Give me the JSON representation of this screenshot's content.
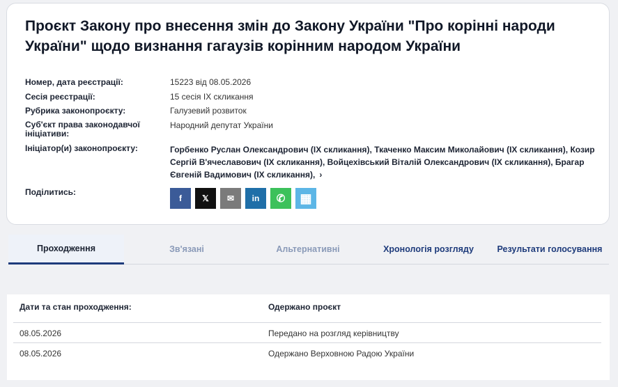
{
  "bill": {
    "title": "Проєкт Закону про внесення змін до Закону України \"Про корінні народи України\" щодо визнання гагаузів корінним народом України",
    "details": [
      {
        "label": "Номер, дата реєстрації:",
        "value": "15223 від 08.05.2026"
      },
      {
        "label": "Сесія реєстрації:",
        "value": "15 сесія IX скликання"
      },
      {
        "label": "Рубрика законопроєкту:",
        "value": "Галузевий розвиток"
      },
      {
        "label": "Суб'єкт права законодавчої ініціативи:",
        "value": "Народний депутат України"
      },
      {
        "label": "Ініціатор(и) законопроєкту:",
        "value": "Горбенко Руслан Олександрович (IX скликання), Ткаченко Максим Миколайович (IX скликання), Козир Сергій В'ячеславович (IX скликання), Войцехівський Віталій Олександрович (IX скликання), Брагар Євгеній Вадимович (IX скликання),"
      }
    ],
    "more_glyph": "›",
    "share_label": "Поділитись:",
    "share_buttons": [
      {
        "icon": "facebook-icon",
        "glyph": "f"
      },
      {
        "icon": "x-twitter-icon",
        "glyph": "𝕏"
      },
      {
        "icon": "email-icon",
        "glyph": "✉"
      },
      {
        "icon": "linkedin-icon",
        "glyph": "in"
      },
      {
        "icon": "whatsapp-icon",
        "glyph": "✆"
      },
      {
        "icon": "qr-code-icon",
        "glyph": "▦"
      }
    ]
  },
  "tabs": [
    {
      "label": "Проходження",
      "state": "active"
    },
    {
      "label": "Зв'язані",
      "state": "disabled"
    },
    {
      "label": "Альтернативні",
      "state": "disabled"
    },
    {
      "label": "Хронологія розгляду",
      "state": "link"
    },
    {
      "label": "Результати голосування",
      "state": "link"
    }
  ],
  "passage": {
    "headers": [
      "Дати та стан проходження:",
      "Одержано проєкт"
    ],
    "rows": [
      {
        "date": "08.05.2026",
        "status": "Передано на розгляд керівництву"
      },
      {
        "date": "08.05.2026",
        "status": "Одержано Верховною Радою України"
      }
    ]
  }
}
